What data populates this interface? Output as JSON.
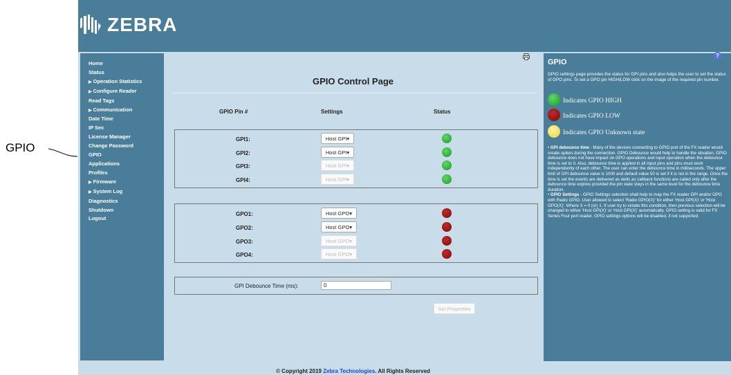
{
  "callout": {
    "label": "GPIO"
  },
  "brand": {
    "name": "ZEBRA"
  },
  "sidebar": {
    "items": [
      {
        "label": "Home",
        "caret": false
      },
      {
        "label": "Status",
        "caret": false
      },
      {
        "label": "Operation Statistics",
        "caret": true
      },
      {
        "label": "Configure Reader",
        "caret": true
      },
      {
        "label": "Read Tags",
        "caret": false
      },
      {
        "label": "Communication",
        "caret": true
      },
      {
        "label": "Date Time",
        "caret": false
      },
      {
        "label": "IP Sec",
        "caret": false
      },
      {
        "label": "License Manager",
        "caret": false
      },
      {
        "label": "Change Password",
        "caret": false
      },
      {
        "label": "GPIO",
        "caret": false
      },
      {
        "label": "Applications",
        "caret": false
      },
      {
        "label": "Profiles",
        "caret": false
      },
      {
        "label": "Firmware",
        "caret": true
      },
      {
        "label": "System Log",
        "caret": true
      },
      {
        "label": "Diagnostics",
        "caret": false
      },
      {
        "label": "Shutdown",
        "caret": false
      },
      {
        "label": "Logout",
        "caret": false
      }
    ]
  },
  "main": {
    "title": "GPIO Control Page",
    "columns": {
      "pin": "GPIO Pin #",
      "settings": "Settings",
      "status": "Status"
    },
    "gpi": [
      {
        "pin": "GPI1:",
        "setting": "Host GPI",
        "enabled": true,
        "status": "high"
      },
      {
        "pin": "GPI2:",
        "setting": "Host GPI",
        "enabled": true,
        "status": "high"
      },
      {
        "pin": "GPI3:",
        "setting": "Host GPI",
        "enabled": false,
        "status": "high"
      },
      {
        "pin": "GPI4:",
        "setting": "Host GPI",
        "enabled": false,
        "status": "high"
      }
    ],
    "gpo": [
      {
        "pin": "GPO1:",
        "setting": "Host GPO",
        "enabled": true,
        "status": "low"
      },
      {
        "pin": "GPO2:",
        "setting": "Host GPO",
        "enabled": true,
        "status": "low"
      },
      {
        "pin": "GPO3:",
        "setting": "Host GPO",
        "enabled": false,
        "status": "low"
      },
      {
        "pin": "GPO4:",
        "setting": "Host GPO",
        "enabled": false,
        "status": "low"
      }
    ],
    "debounce": {
      "label": "GPI Debounce Time (ms):",
      "value": "0"
    },
    "set_button": "Set Properties"
  },
  "footer": {
    "prefix": "© Copyright 2019 ",
    "link": "Zebra Technologies",
    "suffix": ". All Rights Reserved"
  },
  "help": {
    "title": "GPIO",
    "intro": "GPIO settings page provides the status for GPI pins and also helps the user to set the status of GPO pins. To set a GPO pin HIGH/LOW click on the image of the required pin number.",
    "legend_high": "Indicates GPIO HIGH",
    "legend_low": "Indicates GPIO LOW",
    "legend_unknown": "Indicates GPIO Unknown state",
    "debounce_heading": "GPI debounce time",
    "debounce_text": " - Many of the devices connecting to GPIO port of the FX reader would create spikes during the connection. GPIO Debounce would help to handle the situation. GPIO debounce does not have impact on GPO operations and input operation when the debounce time is set to 0. Also, debounce time is applied in all input pins and pins must work independently of each other. The user can enter the debounce time in milliseconds. The upper limit of GPI debounce value is 1000 and default value 50 is set if it is not in the range. Once the time is set the events are delivered as wells as callback functions are called only after the debounce time expires provided the pin state stays in the same level for the debounce time duration.",
    "settings_heading": "GPIO Settings",
    "settings_text": " - GPIO Settings selection shall help to map the FX reader GPI and/or GPO with Radio GPIO. User allowed to select 'Radio GPIO(X)' for either 'Host GPI(X)' or 'Host GPO(X)'. Where X = 0 (or) 1. If user try to violate this condition, then previous selection will be changed to either 'Host GPI(X)' or 'Host GPI(X)' automatically. GPIO setting is valid for FX Series Four port reader. GPIO settings options will be disabled, if not supported."
  }
}
